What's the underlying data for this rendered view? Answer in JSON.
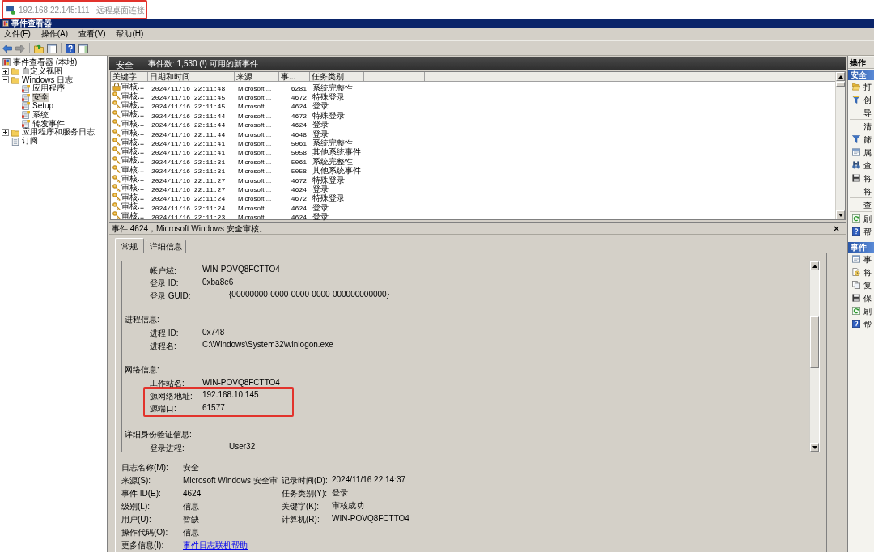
{
  "remote_window": {
    "title": "192.168.22.145:111 - 远程桌面连接",
    "highlighted": true
  },
  "app_window": {
    "title": "事件查看器"
  },
  "menu": [
    "文件(F)",
    "操作(A)",
    "查看(V)",
    "帮助(H)"
  ],
  "tree": [
    {
      "label": "事件查看器 (本地)",
      "selected": false,
      "children": [
        {
          "label": "自定义视图",
          "expanded": false,
          "selected": false
        },
        {
          "label": "Windows 日志",
          "expanded": true,
          "selected": false,
          "children": [
            {
              "label": "应用程序",
              "selected": false
            },
            {
              "label": "安全",
              "selected": true
            },
            {
              "label": "Setup",
              "selected": false
            },
            {
              "label": "系统",
              "selected": false
            },
            {
              "label": "转发事件",
              "selected": false
            }
          ]
        },
        {
          "label": "应用程序和服务日志",
          "expanded": false,
          "selected": false
        },
        {
          "label": "订阅",
          "selected": false
        }
      ]
    }
  ],
  "event_list": {
    "log_name": "安全",
    "summary": "事件数: 1,530 (!) 可用的新事件",
    "columns": [
      "关键字",
      "日期和时间",
      "来源",
      "事...",
      "任务类别"
    ],
    "rows": [
      {
        "kind": "audit_failure",
        "keyword": "审核...",
        "datetime": "2024/11/16 22:11:48",
        "source": "Microsoft ...",
        "event_id": "6281",
        "task_category": "系统完整性"
      },
      {
        "kind": "audit_success",
        "keyword": "审核...",
        "datetime": "2024/11/16 22:11:45",
        "source": "Microsoft ...",
        "event_id": "4672",
        "task_category": "特殊登录"
      },
      {
        "kind": "audit_success",
        "keyword": "审核...",
        "datetime": "2024/11/16 22:11:45",
        "source": "Microsoft ...",
        "event_id": "4624",
        "task_category": "登录"
      },
      {
        "kind": "audit_success",
        "keyword": "审核...",
        "datetime": "2024/11/16 22:11:44",
        "source": "Microsoft ...",
        "event_id": "4672",
        "task_category": "特殊登录"
      },
      {
        "kind": "audit_success",
        "keyword": "审核...",
        "datetime": "2024/11/16 22:11:44",
        "source": "Microsoft ...",
        "event_id": "4624",
        "task_category": "登录"
      },
      {
        "kind": "audit_success",
        "keyword": "审核...",
        "datetime": "2024/11/16 22:11:44",
        "source": "Microsoft ...",
        "event_id": "4648",
        "task_category": "登录"
      },
      {
        "kind": "audit_success",
        "keyword": "审核...",
        "datetime": "2024/11/16 22:11:41",
        "source": "Microsoft ...",
        "event_id": "5061",
        "task_category": "系统完整性"
      },
      {
        "kind": "audit_success",
        "keyword": "审核...",
        "datetime": "2024/11/16 22:11:41",
        "source": "Microsoft ...",
        "event_id": "5058",
        "task_category": "其他系统事件"
      },
      {
        "kind": "audit_success",
        "keyword": "审核...",
        "datetime": "2024/11/16 22:11:31",
        "source": "Microsoft ...",
        "event_id": "5061",
        "task_category": "系统完整性"
      },
      {
        "kind": "audit_success",
        "keyword": "审核...",
        "datetime": "2024/11/16 22:11:31",
        "source": "Microsoft ...",
        "event_id": "5058",
        "task_category": "其他系统事件"
      },
      {
        "kind": "audit_success",
        "keyword": "审核...",
        "datetime": "2024/11/16 22:11:27",
        "source": "Microsoft ...",
        "event_id": "4672",
        "task_category": "特殊登录"
      },
      {
        "kind": "audit_success",
        "keyword": "审核...",
        "datetime": "2024/11/16 22:11:27",
        "source": "Microsoft ...",
        "event_id": "4624",
        "task_category": "登录"
      },
      {
        "kind": "audit_success",
        "keyword": "审核...",
        "datetime": "2024/11/16 22:11:24",
        "source": "Microsoft ...",
        "event_id": "4672",
        "task_category": "特殊登录"
      },
      {
        "kind": "audit_success",
        "keyword": "审核...",
        "datetime": "2024/11/16 22:11:24",
        "source": "Microsoft ...",
        "event_id": "4624",
        "task_category": "登录"
      },
      {
        "kind": "audit_success",
        "keyword": "审核...",
        "datetime": "2024/11/16 22:11:23",
        "source": "Microsoft ...",
        "event_id": "4624",
        "task_category": "登录"
      }
    ]
  },
  "event_detail": {
    "title": "事件 4624，Microsoft Windows 安全审核。",
    "tabs": [
      {
        "label": "常规",
        "selected": true
      },
      {
        "label": "详细信息",
        "selected": false
      }
    ],
    "description": [
      {
        "rows": [
          {
            "label": "帐户域:",
            "value": "WIN-POVQ8FCTTO4",
            "kind": "tab1",
            "highlighted": false
          },
          {
            "label": "登录 ID:",
            "value": "0xba8e6",
            "kind": "tab1",
            "highlighted": false
          },
          {
            "label": "登录 GUID:",
            "value": "{00000000-0000-0000-0000-000000000000}",
            "kind": "tab2",
            "highlighted": false
          }
        ]
      },
      {
        "heading": "进程信息:",
        "rows": [
          {
            "label": "进程 ID:",
            "value": "0x748",
            "kind": "tab1",
            "highlighted": false
          },
          {
            "label": "进程名:",
            "value": "C:\\Windows\\System32\\winlogon.exe",
            "kind": "tab1",
            "highlighted": false
          }
        ]
      },
      {
        "heading": "网络信息:",
        "rows": [
          {
            "label": "工作站名:",
            "value": "WIN-POVQ8FCTTO4",
            "kind": "tab1",
            "highlighted": false
          },
          {
            "label": "源网络地址:",
            "value": "192.168.10.145",
            "kind": "tab1",
            "highlighted": true
          },
          {
            "label": "源端口:",
            "value": "61577",
            "kind": "tab1",
            "highlighted": true
          }
        ]
      },
      {
        "heading": "详细身份验证信息:",
        "rows": [
          {
            "label": "登录进程:",
            "value": "User32",
            "kind": "tab2",
            "highlighted": false
          }
        ]
      }
    ],
    "fields": [
      {
        "left": {
          "label": "日志名称(M):",
          "value": "安全"
        }
      },
      {
        "left": {
          "label": "来源(S):",
          "value": "Microsoft Windows 安全审"
        },
        "right": {
          "label": "记录时间(D):",
          "value": "2024/11/16 22:14:37"
        }
      },
      {
        "left": {
          "label": "事件 ID(E):",
          "value": "4624"
        },
        "right": {
          "label": "任务类别(Y):",
          "value": "登录"
        }
      },
      {
        "left": {
          "label": "级别(L):",
          "value": "信息"
        },
        "right": {
          "label": "关键字(K):",
          "value": "审核成功"
        }
      },
      {
        "left": {
          "label": "用户(U):",
          "value": "暂缺"
        },
        "right": {
          "label": "计算机(R):",
          "value": "WIN-POVQ8FCTTO4"
        }
      },
      {
        "left": {
          "label": "操作代码(O):",
          "value": "信息"
        }
      },
      {
        "left": {
          "label": "更多信息(I):",
          "value": "事件日志联机帮助",
          "kind": "link"
        }
      }
    ]
  },
  "actions": {
    "title": "操作",
    "sections": [
      {
        "title": "安全",
        "groups": [
          [
            "打",
            "创",
            "导"
          ],
          [
            "清",
            "筛",
            "属",
            "查",
            "将",
            "将"
          ],
          [
            "查"
          ],
          [
            "刷",
            "帮"
          ]
        ]
      },
      {
        "title": "事件",
        "groups": [
          [
            "事",
            "将",
            "复",
            "保",
            "刷",
            "帮"
          ]
        ]
      }
    ]
  }
}
